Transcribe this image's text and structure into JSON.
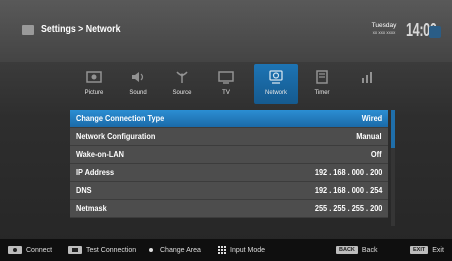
{
  "header": {
    "breadcrumb": "Settings > Network",
    "day": "Tuesday",
    "date": "xx xxx xxxx",
    "time": "14:00"
  },
  "tabs": [
    {
      "label": "Picture",
      "icon": "picture-icon",
      "active": false
    },
    {
      "label": "Sound",
      "icon": "sound-icon",
      "active": false
    },
    {
      "label": "Source",
      "icon": "source-icon",
      "active": false
    },
    {
      "label": "TV",
      "icon": "tv-icon",
      "active": false
    },
    {
      "label": "Network",
      "icon": "network-icon",
      "active": true
    },
    {
      "label": "Timer",
      "icon": "timer-icon",
      "active": false
    },
    {
      "label": "",
      "icon": "parental-icon",
      "active": false
    }
  ],
  "menu": [
    {
      "label": "Change Connection Type",
      "value": "Wired",
      "selected": true
    },
    {
      "label": "Network Configuration",
      "value": "Manual",
      "selected": false
    },
    {
      "label": "Wake-on-LAN",
      "value": "Off",
      "selected": false
    },
    {
      "label": "IP Address",
      "value": "192 . 168 . 000 . 200",
      "selected": false
    },
    {
      "label": "DNS",
      "value": "192 . 168 . 000 . 254",
      "selected": false
    },
    {
      "label": "Netmask",
      "value": "255 . 255 . 255 . 200",
      "selected": false
    }
  ],
  "footer": {
    "connect": "Connect",
    "test_connection": "Test Connection",
    "change_area": "Change Area",
    "input_mode": "Input Mode",
    "back_key": "BACK",
    "back": "Back",
    "exit_key": "EXIT",
    "exit": "Exit"
  },
  "colors": {
    "accent": "#1b6aa8",
    "active_tab": "#1d74b4",
    "row_bg": "#4d4d4d",
    "footer_bg": "#0f0f0f"
  }
}
